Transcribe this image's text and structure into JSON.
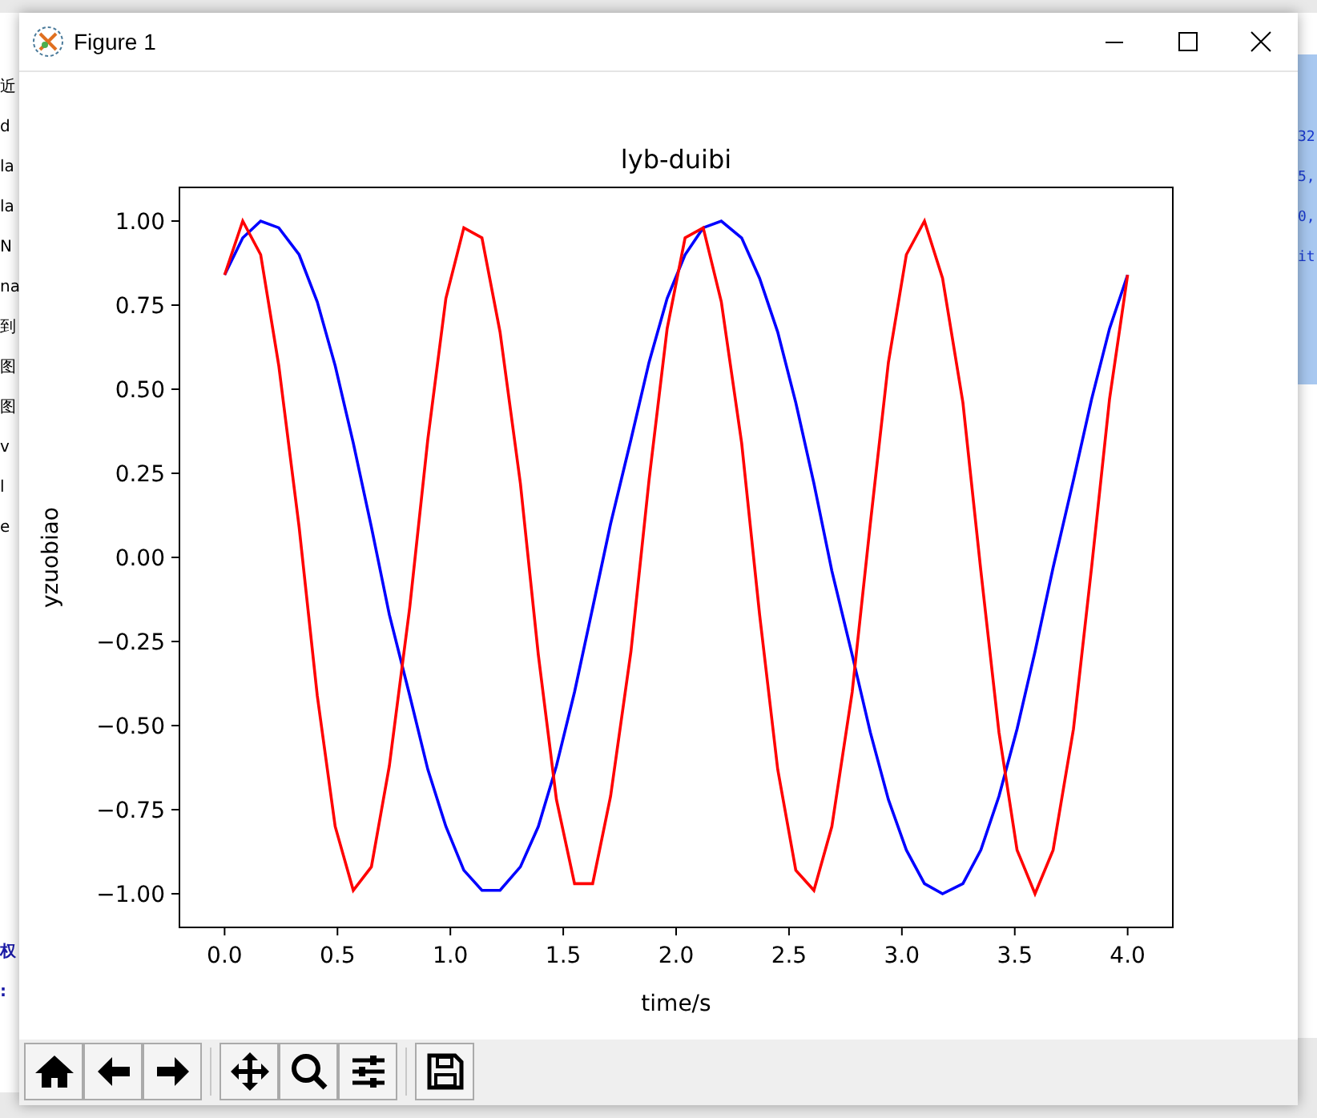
{
  "background": {
    "left_lines": [
      "近",
      "d",
      "la",
      "la",
      "N",
      "na",
      "到",
      "图",
      "图",
      "v",
      "l",
      "e"
    ],
    "left_bottom": [
      "权",
      ":"
    ],
    "right_lines": [
      "32",
      "5,",
      "0,",
      "it"
    ]
  },
  "window": {
    "title": "Figure 1"
  },
  "chart_data": {
    "type": "line",
    "title": "lyb-duibi",
    "xlabel": "time/s",
    "ylabel": "yzuobiao",
    "xlim": [
      -0.2,
      4.2
    ],
    "ylim": [
      -1.1,
      1.1
    ],
    "xticks": [
      {
        "value": 0,
        "label": "0.0"
      },
      {
        "value": 0.5,
        "label": "0.5"
      },
      {
        "value": 1,
        "label": "1.0"
      },
      {
        "value": 1.5,
        "label": "1.5"
      },
      {
        "value": 2,
        "label": "2.0"
      },
      {
        "value": 2.5,
        "label": "2.5"
      },
      {
        "value": 3,
        "label": "3.0"
      },
      {
        "value": 3.5,
        "label": "3.5"
      },
      {
        "value": 4,
        "label": "4.0"
      }
    ],
    "yticks": [
      {
        "value": -1,
        "label": "−1.00"
      },
      {
        "value": -0.75,
        "label": "−0.75"
      },
      {
        "value": -0.5,
        "label": "−0.50"
      },
      {
        "value": -0.25,
        "label": "−0.25"
      },
      {
        "value": 0,
        "label": "0.00"
      },
      {
        "value": 0.25,
        "label": "0.25"
      },
      {
        "value": 0.5,
        "label": "0.50"
      },
      {
        "value": 0.75,
        "label": "0.75"
      },
      {
        "value": 1,
        "label": "1.00"
      }
    ],
    "x": [
      0,
      0.08,
      0.16,
      0.24,
      0.33,
      0.41,
      0.49,
      0.57,
      0.65,
      0.73,
      0.82,
      0.9,
      0.98,
      1.06,
      1.14,
      1.22,
      1.31,
      1.39,
      1.47,
      1.55,
      1.63,
      1.71,
      1.8,
      1.88,
      1.96,
      2.04,
      2.12,
      2.2,
      2.29,
      2.37,
      2.45,
      2.53,
      2.61,
      2.69,
      2.78,
      2.86,
      2.94,
      3.02,
      3.1,
      3.18,
      3.27,
      3.35,
      3.43,
      3.51,
      3.59,
      3.67,
      3.76,
      3.84,
      3.92,
      4.0
    ],
    "series": [
      {
        "color": "#0000ff",
        "values": [
          0.84,
          0.95,
          1.0,
          0.98,
          0.9,
          0.76,
          0.57,
          0.34,
          0.09,
          -0.17,
          -0.41,
          -0.63,
          -0.8,
          -0.93,
          -0.99,
          -0.99,
          -0.92,
          -0.8,
          -0.62,
          -0.4,
          -0.15,
          0.1,
          0.35,
          0.58,
          0.77,
          0.9,
          0.98,
          1.0,
          0.95,
          0.83,
          0.67,
          0.46,
          0.22,
          -0.04,
          -0.29,
          -0.52,
          -0.72,
          -0.87,
          -0.97,
          -1.0,
          -0.97,
          -0.87,
          -0.71,
          -0.51,
          -0.28,
          -0.03,
          0.23,
          0.47,
          0.68,
          0.84
        ]
      },
      {
        "color": "#ff0000",
        "values": [
          0.84,
          1.0,
          0.9,
          0.57,
          0.09,
          -0.41,
          -0.8,
          -0.99,
          -0.92,
          -0.62,
          -0.15,
          0.35,
          0.77,
          0.98,
          0.95,
          0.67,
          0.22,
          -0.29,
          -0.72,
          -0.97,
          -0.97,
          -0.71,
          -0.28,
          0.23,
          0.68,
          0.95,
          0.98,
          0.76,
          0.34,
          -0.17,
          -0.63,
          -0.93,
          -0.99,
          -0.8,
          -0.4,
          0.1,
          0.58,
          0.9,
          1.0,
          0.83,
          0.46,
          -0.04,
          -0.52,
          -0.87,
          -1.0,
          -0.87,
          -0.51,
          -0.03,
          0.47,
          0.84
        ]
      }
    ]
  }
}
